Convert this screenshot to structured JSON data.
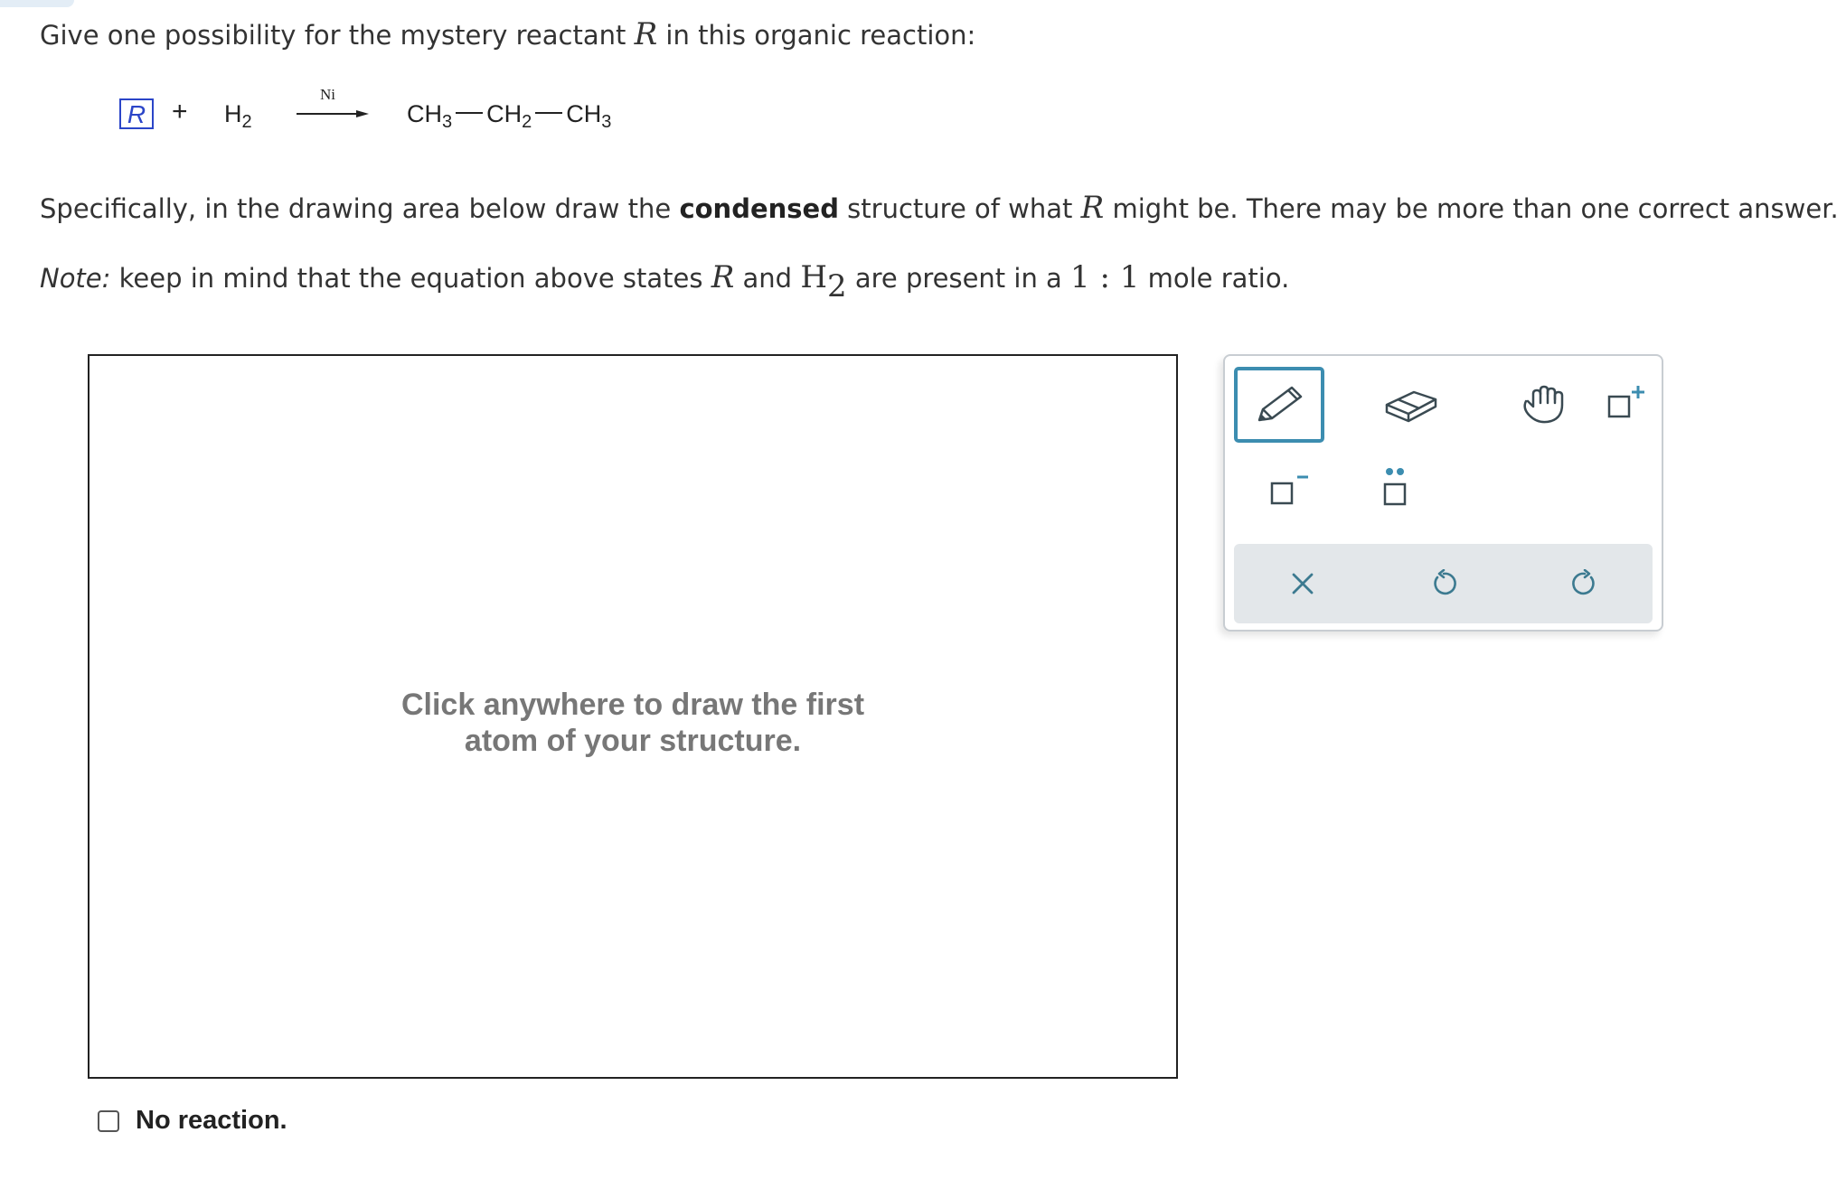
{
  "question": {
    "line1_prefix": "Give one possibility for the mystery reactant ",
    "reactant_symbol": "R",
    "line1_suffix": " in this organic reaction:",
    "line2_prefix": "Specifically, in the drawing area below draw the ",
    "line2_bold": "condensed",
    "line2_mid": " structure of what ",
    "line2_suffix": " might be. There may be more than one correct answer.",
    "note_label": "Note:",
    "note_prefix": " keep in mind that the equation above states ",
    "note_and": " and ",
    "h2_symbol": "H",
    "h2_subscript": "2",
    "note_mid": " are present in a ",
    "ratio": "1 : 1",
    "note_suffix": " mole ratio."
  },
  "reaction": {
    "reactant_box": "R",
    "plus": "+",
    "h2": "H",
    "h2_sub": "2",
    "catalyst": "Ni",
    "product": {
      "group1": "CH",
      "group1_sub": "3",
      "group2": "CH",
      "group2_sub": "2",
      "group3": "CH",
      "group3_sub": "3"
    }
  },
  "canvas": {
    "hint": "Click anywhere to draw the first atom of your structure."
  },
  "toolbox": {
    "tools": [
      "pencil",
      "eraser",
      "hand",
      "add-charge",
      "negative-charge",
      "lone-pair"
    ],
    "selected_tool": "pencil",
    "actions": [
      "clear",
      "undo",
      "redo"
    ],
    "accent_color": "#3c8db0",
    "icon_color": "#3c7a90"
  },
  "no_reaction": {
    "label": "No reaction.",
    "checked": false
  }
}
